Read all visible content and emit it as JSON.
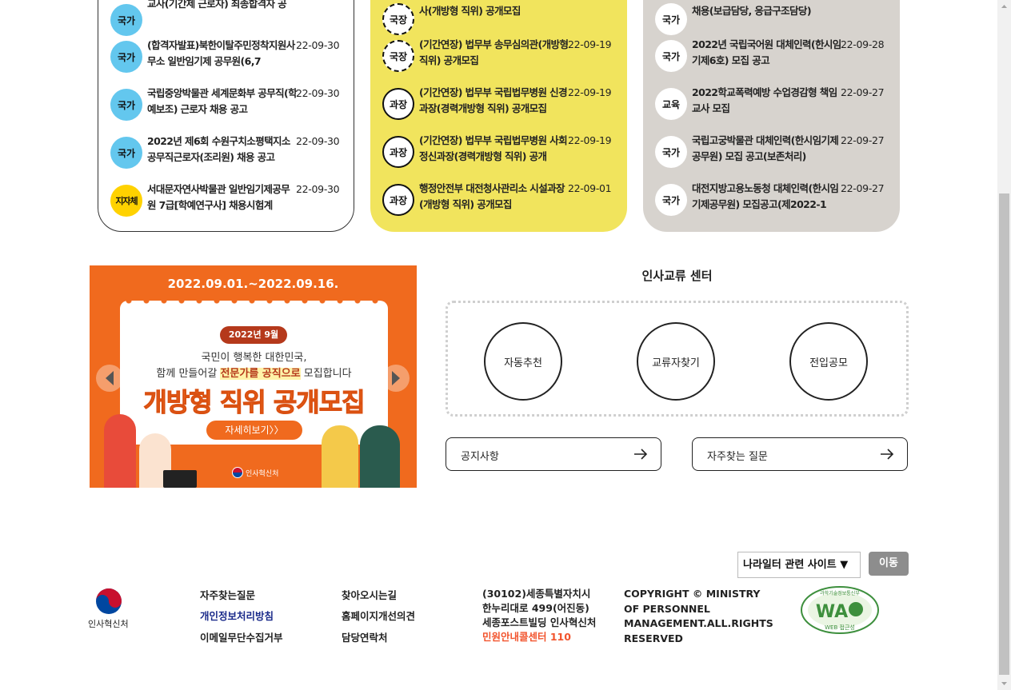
{
  "cards": {
    "national": {
      "rows": [
        {
          "badge": "국가",
          "title": "교사(기간제 근로자) 최종합격자 공",
          "date": ""
        },
        {
          "badge": "국가",
          "title": "(합격자발표)북한이탈주민정착지원사무소 일반임기제 공무원(6,7",
          "date": "22-09-30"
        },
        {
          "badge": "국가",
          "title": "국립중앙박물관 세계문화부 공무직(학예보조) 근로자 채용 공고",
          "date": "22-09-30"
        },
        {
          "badge": "국가",
          "title": "2022년 제6회 수원구치소평택지소 공무직근로자(조리원) 채용 공고",
          "date": "22-09-30"
        },
        {
          "badge": "지자체",
          "title": "서대문자연사박물관 일반임기제공무원 7급[학예연구사] 채용시험계",
          "date": "22-09-30"
        }
      ]
    },
    "open": {
      "rows": [
        {
          "badge": "국장",
          "title": "사(개방형 직위) 공개모집",
          "date": ""
        },
        {
          "badge": "국장",
          "title": "(기간연장) 법무부 송무심의관(개방형 직위) 공개모집",
          "date": "22-09-19"
        },
        {
          "badge": "과장",
          "title": "(기간연장) 법무부 국립법무병원 신경과장(경력개방형 직위) 공개모집",
          "date": "22-09-19"
        },
        {
          "badge": "과장",
          "title": "(기간연장) 법무부 국립법무병원 사회정신과장(경력개방형 직위) 공개",
          "date": "22-09-19"
        },
        {
          "badge": "과장",
          "title": "행정안전부 대전청사관리소 시설과장(개방형 직위) 공개모집",
          "date": "22-09-01"
        }
      ]
    },
    "substitute": {
      "rows": [
        {
          "badge": "국가",
          "title": "채용(보급담당, 응급구조담당)",
          "date": ""
        },
        {
          "badge": "국가",
          "title": "2022년 국립국어원 대체인력(한시임기제6호) 모집 공고",
          "date": "22-09-28"
        },
        {
          "badge": "교육",
          "title": "2022학교폭력예방 수업경감형 책임교사 모집",
          "date": "22-09-27"
        },
        {
          "badge": "국가",
          "title": "국립고궁박물관 대체인력(한시임기제공무원) 모집 공고(보존처리)",
          "date": "22-09-27"
        },
        {
          "badge": "국가",
          "title": "대전지방고용노동청 대체인력(한시임기제공무원) 모집공고(제2022-1",
          "date": "22-09-27"
        }
      ]
    }
  },
  "banner": {
    "period": "2022.09.01.~2022.09.16.",
    "badge": "2022년 9월",
    "line1": "국민이 행복한 대한민국,",
    "line2_a": "함께 만들어갈 ",
    "line2_highlight": "전문가를 공직으로",
    "line2_b": " 모집합니다",
    "title": "개방형 직위 공개모집",
    "button": "자세히보기〉〉",
    "logo": "인사혁신처"
  },
  "exchange": {
    "title": "인사교류 센터",
    "circles": [
      "자동추천",
      "교류자찾기",
      "전입공모"
    ],
    "notice": "공지사항",
    "faq": "자주찾는 질문"
  },
  "footer": {
    "site_select": "나라일터 관련 사이트 ▼",
    "go": "이동",
    "logo_text": "인사혁신처",
    "links_col1": [
      "자주찾는질문",
      "개인정보처리방침",
      "이메일무단수집거부"
    ],
    "links_col2": [
      "찾아오시는길",
      "홈페이지개선의견",
      "담당연락처"
    ],
    "address": [
      "(30102)세종특별자치시",
      "한누리대로 499(어진동)",
      "세종포스트빌딩 인사혁신처"
    ],
    "callcenter": "민원안내콜센터 110",
    "copyright": "COPYRIGHT © MINISTRY OF PERSONNEL MANAGEMENT.ALL.RIGHTS RESERVED",
    "wa_top": "과학기술정보통신부",
    "wa_mark": "WA",
    "wa_bottom": "WEB 접근성"
  },
  "colors": {
    "yellow_card": "#f1e45d",
    "gray_card": "#d7d3ce",
    "badge_sky": "#63c7ee",
    "badge_gold": "#ffd200",
    "banner_orange": "#f06a1e",
    "privacy_link": "#1a2a8a",
    "callcenter": "#f2542d"
  }
}
